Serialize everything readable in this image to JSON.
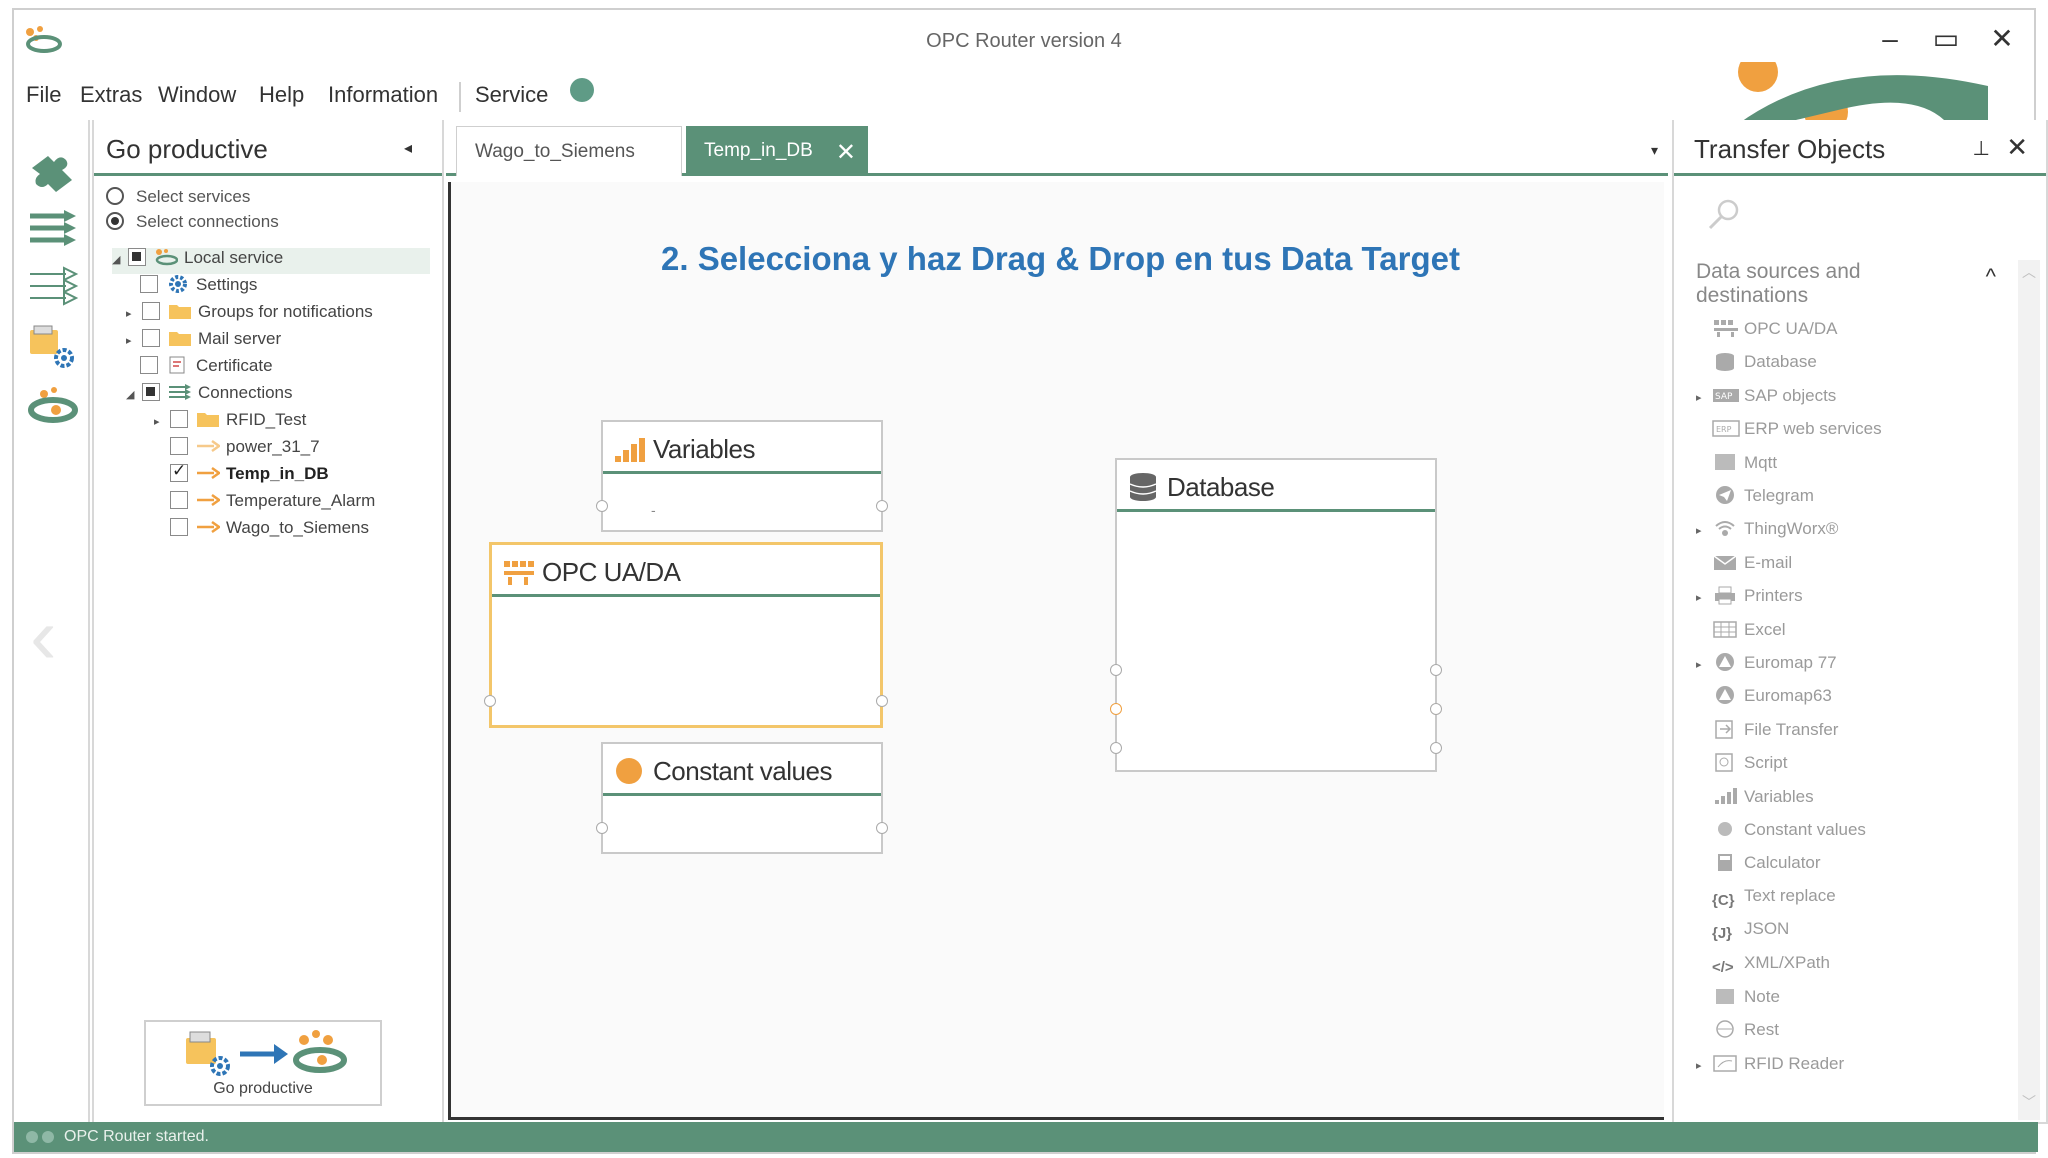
{
  "window": {
    "title": "OPC Router version 4",
    "min": "–",
    "max": "▭",
    "close": "✕"
  },
  "menu": {
    "items": [
      "File",
      "Extras",
      "Window",
      "Help",
      "Information"
    ],
    "service": "Service",
    "service_status_color": "#5f9b86"
  },
  "left_panel": {
    "title": "Go productive",
    "collapse": "◂",
    "radios": [
      {
        "label": "Select services",
        "selected": false
      },
      {
        "label": "Select connections",
        "selected": true
      }
    ],
    "tree": [
      {
        "label": "Local service",
        "level": 0,
        "expand": "◢",
        "check": "part",
        "icon": "local-service-icon"
      },
      {
        "label": "Settings",
        "level": 1,
        "expand": "",
        "check": "none",
        "icon": "gear-icon"
      },
      {
        "label": "Groups for notifications",
        "level": 1,
        "expand": "▸",
        "check": "none",
        "icon": "folder-icon"
      },
      {
        "label": "Mail server",
        "level": 1,
        "expand": "▸",
        "check": "none",
        "icon": "folder-icon"
      },
      {
        "label": "Certificate",
        "level": 1,
        "expand": "",
        "check": "none",
        "icon": "certificate-icon"
      },
      {
        "label": "Connections",
        "level": 1,
        "expand": "◢",
        "check": "part",
        "icon": "connections-icon"
      },
      {
        "label": "RFID_Test",
        "level": 2,
        "expand": "▸",
        "check": "none",
        "icon": "folder-icon"
      },
      {
        "label": "power_31_7",
        "level": 2,
        "expand": "",
        "check": "none",
        "icon": "connection-inactive-icon"
      },
      {
        "label": "Temp_in_DB",
        "level": 2,
        "expand": "",
        "check": "checked",
        "icon": "connection-icon",
        "bold": true
      },
      {
        "label": "Temperature_Alarm",
        "level": 2,
        "expand": "",
        "check": "none",
        "icon": "connection-icon"
      },
      {
        "label": "Wago_to_Siemens",
        "level": 2,
        "expand": "",
        "check": "none",
        "icon": "connection-icon"
      }
    ],
    "go_button": "Go productive"
  },
  "tabs": {
    "items": [
      "Wago_to_Siemens",
      "Temp_in_DB"
    ],
    "active": 1,
    "close": "✕",
    "dropdown": "▾"
  },
  "canvas": {
    "instruction": "2. Selecciona y haz Drag & Drop en tus Data Target",
    "blocks": {
      "variables": {
        "title": "Variables",
        "body": "-"
      },
      "opc": {
        "title": "OPC UA/DA"
      },
      "constant": {
        "title": "Constant values"
      },
      "database": {
        "title": "Database"
      }
    }
  },
  "right_panel": {
    "title": "Transfer Objects",
    "pin": "📌",
    "close": "✕",
    "section": "Data sources and destinations",
    "collapse": "^",
    "items": [
      {
        "label": "OPC UA/DA",
        "expand": "",
        "icon": "opc-icon"
      },
      {
        "label": "Database",
        "expand": "",
        "icon": "database-icon"
      },
      {
        "label": "SAP objects",
        "expand": "▸",
        "icon": "sap-icon"
      },
      {
        "label": "ERP web services",
        "expand": "",
        "icon": "erp-icon"
      },
      {
        "label": "Mqtt",
        "expand": "",
        "icon": "mqtt-icon"
      },
      {
        "label": "Telegram",
        "expand": "",
        "icon": "telegram-icon"
      },
      {
        "label": "ThingWorx®",
        "expand": "▸",
        "icon": "thingworx-icon"
      },
      {
        "label": "E-mail",
        "expand": "",
        "icon": "email-icon"
      },
      {
        "label": "Printers",
        "expand": "▸",
        "icon": "printer-icon"
      },
      {
        "label": "Excel",
        "expand": "",
        "icon": "excel-icon"
      },
      {
        "label": "Euromap 77",
        "expand": "▸",
        "icon": "euromap-icon"
      },
      {
        "label": "Euromap63",
        "expand": "",
        "icon": "euromap-icon"
      },
      {
        "label": "File Transfer",
        "expand": "",
        "icon": "file-transfer-icon"
      },
      {
        "label": "Script",
        "expand": "",
        "icon": "script-icon"
      },
      {
        "label": "Variables",
        "expand": "",
        "icon": "variables-icon"
      },
      {
        "label": "Constant values",
        "expand": "",
        "icon": "constant-icon"
      },
      {
        "label": "Calculator",
        "expand": "",
        "icon": "calculator-icon"
      },
      {
        "label": "Text replace",
        "expand": "",
        "icon": "text-replace-icon",
        "glyph": "{C}"
      },
      {
        "label": "JSON",
        "expand": "",
        "icon": "json-icon",
        "glyph": "{J}"
      },
      {
        "label": "XML/XPath",
        "expand": "",
        "icon": "xml-icon",
        "glyph": "</>"
      },
      {
        "label": "Note",
        "expand": "",
        "icon": "note-icon"
      },
      {
        "label": "Rest",
        "expand": "",
        "icon": "rest-icon"
      },
      {
        "label": "RFID Reader",
        "expand": "▸",
        "icon": "rfid-icon"
      }
    ]
  },
  "status": {
    "text": "OPC Router started."
  },
  "colors": {
    "accent": "#5b9178",
    "instruction": "#2e75b6",
    "orange": "#f0a040",
    "selection": "#f3c66a"
  }
}
